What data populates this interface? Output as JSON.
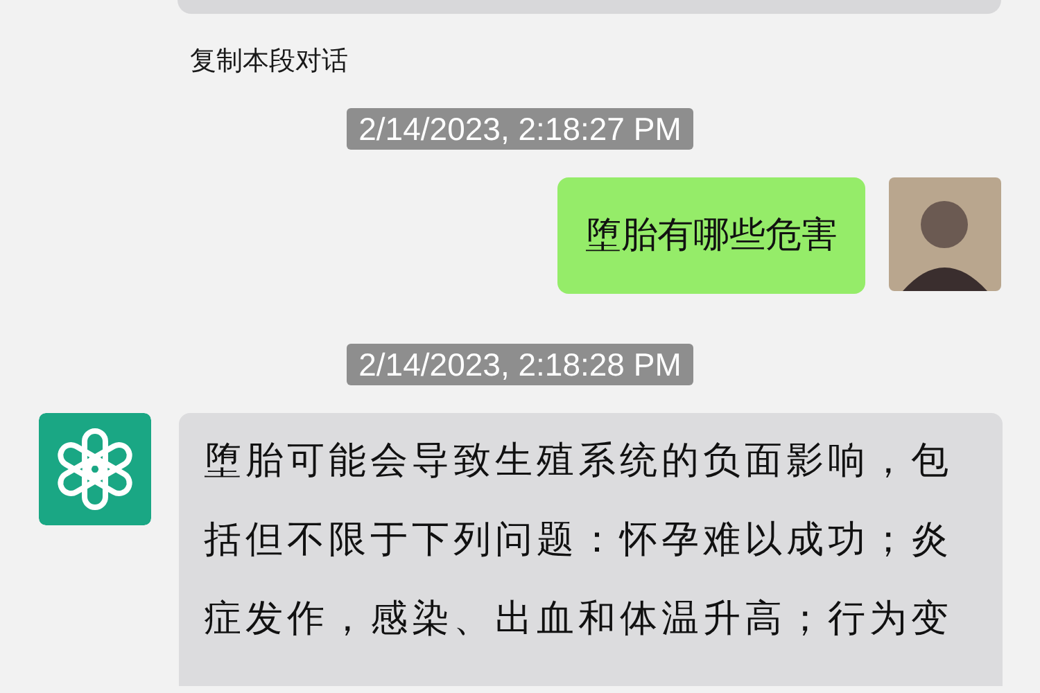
{
  "previous_message": {
    "copy_link": "复制本段对话"
  },
  "messages": [
    {
      "kind": "timestamp",
      "text": "2/14/2023, 2:18:27 PM"
    },
    {
      "kind": "user",
      "text": "堕胎有哪些危害"
    },
    {
      "kind": "timestamp",
      "text": "2/14/2023, 2:18:28 PM"
    },
    {
      "kind": "bot",
      "text": "堕胎可能会导致生殖系统的负面影响，包括但不限于下列问题：怀孕难以成功；炎症发作，感染、出血和体温升高；行为变"
    }
  ]
}
